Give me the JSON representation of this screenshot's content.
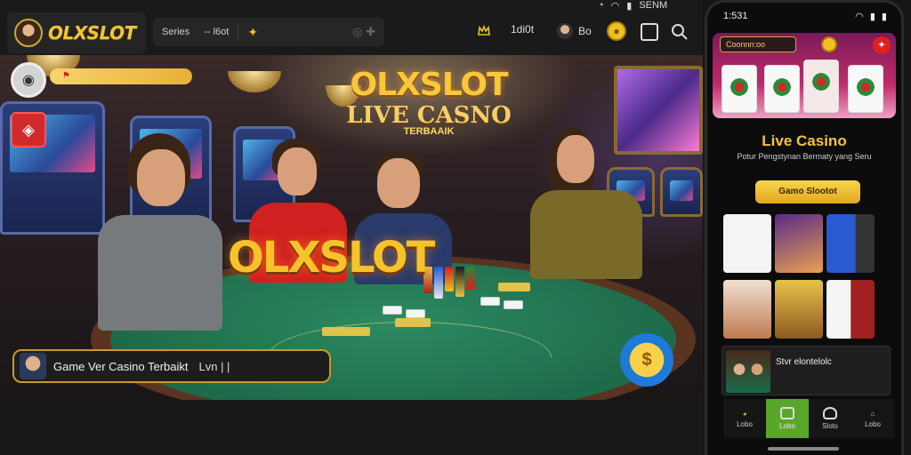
{
  "app": {
    "brand": "OLXSLOT",
    "status_text": "SENM"
  },
  "topbar": {
    "nav_items": [
      "Series",
      "-- l6ot"
    ],
    "tools": [
      {
        "icon": "crown-outline-icon",
        "label": ""
      },
      {
        "icon": "",
        "label": "1di0t"
      },
      {
        "icon": "user-avatar",
        "label": "Bo"
      },
      {
        "icon": "coin-icon",
        "label": ""
      },
      {
        "icon": "wallet-icon",
        "label": ""
      },
      {
        "icon": "search-icon",
        "label": ""
      }
    ]
  },
  "hero": {
    "logo_main": "OLXSLOT",
    "logo_sub": "LIVE CASNO",
    "logo_tag": "TERBAAIK",
    "table_logo": "OLXSLOT",
    "bar_text": "Game Ver Casino Terbaikt",
    "bar_tail": "Lvn   | |"
  },
  "phone": {
    "time": "1:531",
    "pill_label": "Coonnn:oo",
    "title": "Live Casino",
    "subtitle": "Potur Pengstynan Bermaty yang Seru",
    "cta": "Gamo Slootot",
    "row_text": "Stvr elontelolc",
    "nav": [
      {
        "label": "Lobo",
        "active": false
      },
      {
        "label": "Lobo",
        "active": true
      },
      {
        "label": "Slots",
        "active": false
      },
      {
        "label": "Lobo",
        "active": false
      }
    ]
  },
  "colors": {
    "accent": "#f3c534",
    "felt": "#1e6a4a",
    "active_nav": "#5aa62a"
  }
}
